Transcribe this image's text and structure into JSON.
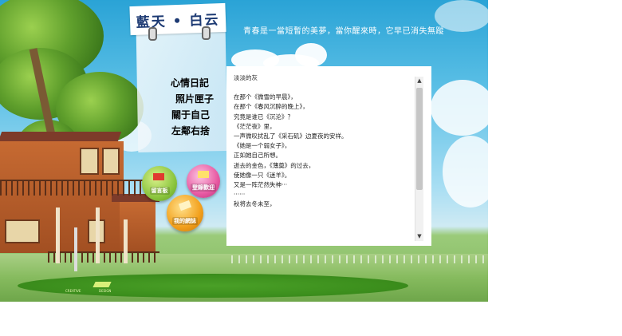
{
  "site": {
    "title": "藍天 • 白云",
    "slogan": "青春是一當短暫的美夢，當你醒來時，它早已消失無蹤"
  },
  "nav": {
    "items": [
      {
        "label": "心情日記"
      },
      {
        "label": "照片匣子"
      },
      {
        "label": "關于自己"
      },
      {
        "label": "左鄰右捨"
      }
    ]
  },
  "bubbles": [
    {
      "label": "留言板",
      "color": "#8cc63f"
    },
    {
      "label": "登錄歡迎",
      "color": "#e85aa3"
    },
    {
      "label": "我的網誌",
      "color": "#f2a01c"
    }
  ],
  "content": {
    "heading": "淡淡的灰",
    "lines": [
      "在那个《微雪的早晨》，",
      "在那个《春风沉醉的晚上》，",
      "究竟是谁已《沉沦》？",
      "",
      "《茫茫夜》里，",
      "一声微叹扰乱了《采石矶》边夏夜的安祥。",
      "《她是一个弱女子》，",
      "正如她自己所想。",
      "逝去的金色，《薄奠》的过去，",
      "使她像一只《迷羊》。",
      "又是一阵茫然失神···",
      "",
      "······",
      "",
      "秋将去冬未至，"
    ]
  },
  "credit": {
    "line1": "CREATIVE",
    "line2": "DESIGN"
  }
}
